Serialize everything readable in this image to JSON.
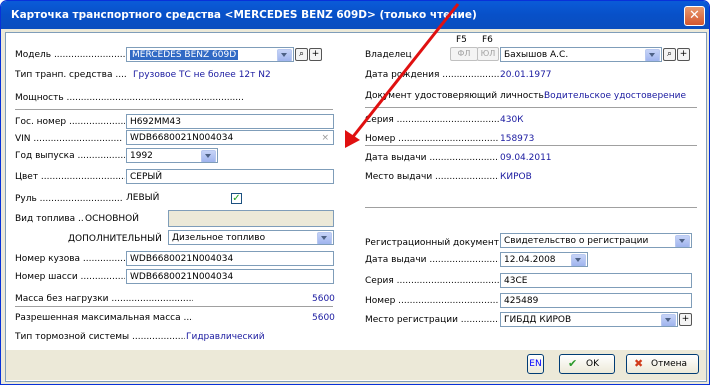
{
  "window": {
    "title": "Карточка транспортного средства  <MERCEDES BENZ 609D> (только чтение)"
  },
  "left": {
    "model_label": "Модель ....................................",
    "model_value": "MERCEDES BENZ 609D",
    "vehicle_type_label": "Тип транп. средства ....",
    "vehicle_type_value": "Грузовое ТС не более 12т N2",
    "power_label": "Мощность .........................................................................................",
    "gos_nomer_label": "Гос. номер ....................",
    "gos_nomer_value": "Н692ММ43",
    "vin_label": "VIN ...............................",
    "vin_value": "WDB6680021N004034",
    "year_label": "Год выпуска .................",
    "year_value": "1992",
    "color_label": "Цвет ..............................",
    "color_value": "СЕРЫЙ",
    "steering_label": "Руль .............................",
    "steering_value": "ЛЕВЫЙ",
    "fuel_label": "Вид топлива .........",
    "fuel_main_label": "ОСНОВНОЙ",
    "fuel_extra_label": "ДОПОЛНИТЕЛЬНЫЙ",
    "fuel_extra_value": "Дизельное топливо",
    "body_number_label": "Номер кузова ...............",
    "body_number_value": "WDB6680021N004034",
    "chassis_label": "Номер шасси ................",
    "chassis_value": "WDB6680021N004034",
    "mass_label": "Масса без нагрузки ..........................................................",
    "mass_value": "5600",
    "max_mass_label": "Разрешенная максимальная масса ..............",
    "max_mass_value": "5600",
    "brake_label": "Тип тормозной системы .......................",
    "brake_value": "Гидравлический"
  },
  "right": {
    "f5": "F5",
    "f6": "F6",
    "fl_btn": "ФЛ",
    "ul_btn": "ЮЛ",
    "owner_label": "Владелец",
    "owner_value": "Бахышов А.С.",
    "birth_label": "Дата рождения ......................",
    "birth_value": "20.01.1977",
    "doc_label": "Документ удостоверяющий личность:",
    "doc_value": "Водительское удостоверение",
    "series_label": "Серия ..........................................",
    "series_value": "430К",
    "number_label": "Номер .........................................",
    "number_value": "158973",
    "issue_date_label": "Дата выдачи ..............................",
    "issue_date_value": "09.04.2011",
    "issue_place_label": "Место выдачи ..........................",
    "issue_place_value": "КИРОВ",
    "reg_doc_label": "Регистрационный документ",
    "reg_doc_value": "Свидетельство о регистрации",
    "reg_issue_label": "Дата выдачи ..........................",
    "reg_issue_value": "12.04.2008",
    "reg_series_label": "Серия ..........................................",
    "reg_series_value": "43СЕ",
    "reg_number_label": "Номер ........................................",
    "reg_number_value": "425489",
    "reg_place_label": "Место регистрации ..............",
    "reg_place_value": "ГИБДД КИРОВ"
  },
  "footer": {
    "lang": "EN",
    "ok": "OK",
    "cancel": "Отмена"
  },
  "colors": {
    "title_bar": "#0a5bd8",
    "value_text": "#1a1aa0",
    "annotation_arrow": "#e01010"
  }
}
